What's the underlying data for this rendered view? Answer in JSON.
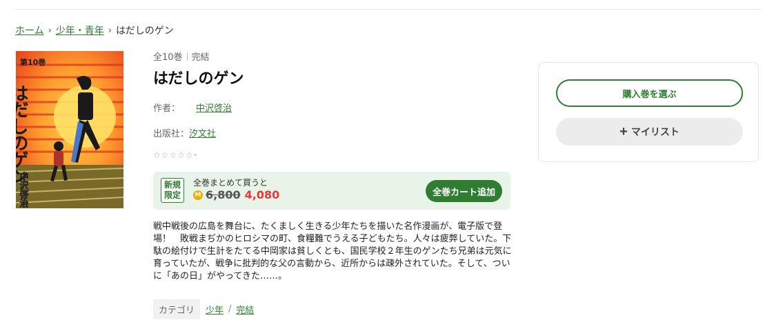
{
  "breadcrumb": {
    "home": "ホーム",
    "category": "少年・青年",
    "current": "はだしのゲン",
    "separator": "›"
  },
  "book": {
    "volumes": "全10巻",
    "status": "完結",
    "title": "はだしのゲン",
    "author_label": "作者：",
    "author": "中沢啓治",
    "publisher_label": "出版社：",
    "publisher": "汐文社",
    "rating_stars": "☆☆☆☆☆",
    "rating_value": "-",
    "cover": {
      "volume_text": "第10巻",
      "title_text": "はだしのゲン",
      "author_text": "中沢啓治"
    }
  },
  "promo": {
    "badge": "新規\n限定",
    "lead": "全巻まとめて買うと",
    "coin": "M",
    "old_price": "6,800",
    "new_price": "4,080",
    "cart_button": "全巻カート追加"
  },
  "description": "戦中戦後の広島を舞台に、たくましく生きる少年たちを描いた名作漫画が、電子版で登場！　敗戦まぢかのヒロシマの町、食糧難でうえる子どもたち。人々は疲弊していた。下駄の絵付けで生計をたてる中岡家は貧しくとも、国民学校２年生のゲンたち兄弟は元気に育っていたが、戦争に批判的な父の言動から、近所からは疎外されていた。そして、ついに「あの日」がやってきた……。",
  "categories": {
    "label": "カテゴリ",
    "items": [
      "少年",
      "完結"
    ],
    "separator": "/"
  },
  "panel": {
    "select_button": "購入巻を選ぶ",
    "mylist_plus": "+",
    "mylist_button": "マイリスト"
  }
}
